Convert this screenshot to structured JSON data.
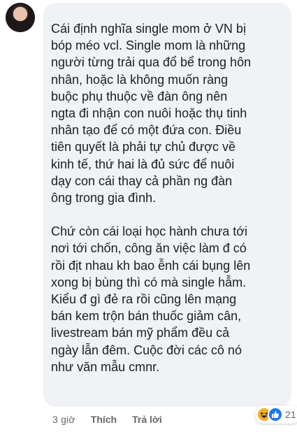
{
  "comment": {
    "paragraphs": [
      "Cái định nghĩa single mom ở VN bị\nbóp méo vcl. Single mom là những\nngười từng trải qua đổ bể trong hôn\nnhân, hoặc là không muốn ràng\nbuộc phụ thuộc về đàn ông nên\nngta đi nhận con nuôi hoặc thụ tinh\nnhân tạo để có một đứa con. Điều\ntiên quyết là phải tự chủ được về\nkinh tế, thứ hai là đủ sức để nuôi\ndạy con cái thay cả phần ng đàn\nông trong gia đình.",
      "Chứ còn cái loại học hành chưa tới\nnơi tới chốn, công ăn việc làm đ có\nrồi địt nhau kh bao ễnh cái bụng lên\nxong bị bùng thì có mà single hẫm.\nKiểu đ gì đẻ ra rồi cũng lên mạng\nbán kem trộn bán thuốc giảm cân,\nlivestream bán mỹ phẩm đều cả\nngày lẫn đêm. Cuộc đời các cô nó\nnhư văn mẫu cmnr."
    ]
  },
  "actions": {
    "time": "3 giờ",
    "like_label": "Thích",
    "reply_label": "Trả lời"
  },
  "reactions": {
    "icons": [
      "haha-icon",
      "like-icon"
    ],
    "count": "21"
  },
  "colors": {
    "bubble": "#f0f2f5",
    "text": "#1c1e21",
    "meta": "#65676b",
    "like": "#1877f2",
    "haha": "#f7b125"
  }
}
